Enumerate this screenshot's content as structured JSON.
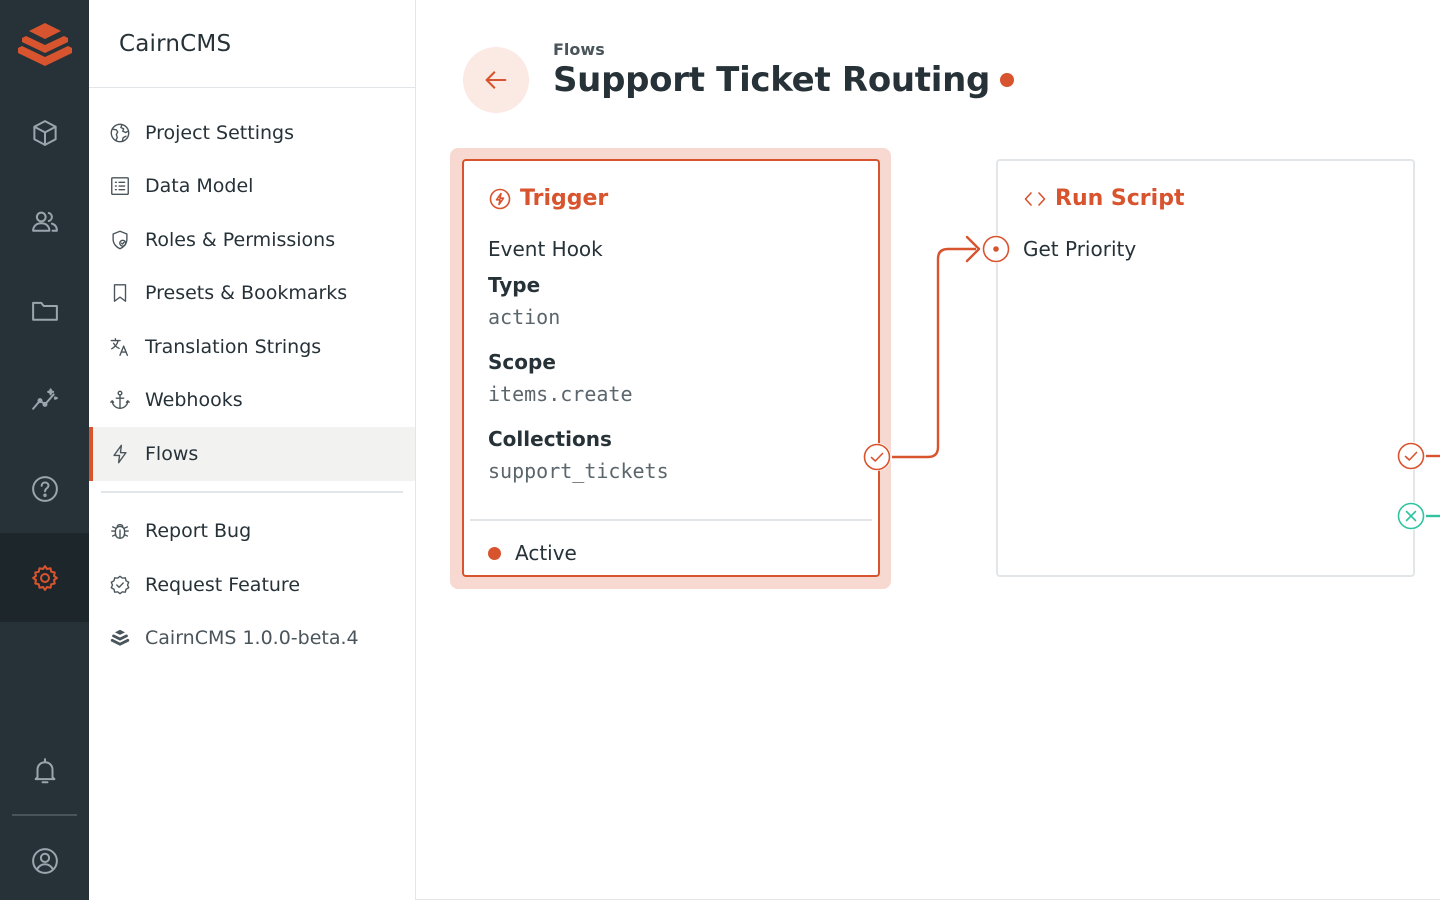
{
  "app": {
    "name": "CairnCMS",
    "accent_color": "#d8542f",
    "rail_color": "#263238",
    "success_color": "#2ec4a0"
  },
  "rail": {
    "logo_icon": "cairn-stack-icon",
    "items": [
      {
        "icon": "box-icon",
        "name": "content"
      },
      {
        "icon": "users-icon",
        "name": "user-directory"
      },
      {
        "icon": "folder-icon",
        "name": "file-library"
      },
      {
        "icon": "insights-icon",
        "name": "insights"
      },
      {
        "icon": "help-icon",
        "name": "documentation"
      },
      {
        "icon": "gear-icon",
        "name": "settings",
        "active": true
      }
    ],
    "bottom": [
      {
        "icon": "bell-icon",
        "name": "notifications"
      },
      {
        "icon": "account-icon",
        "name": "user-profile"
      }
    ]
  },
  "sidebar": {
    "title": "CairnCMS",
    "items": [
      {
        "label": "Project Settings",
        "icon": "globe-icon"
      },
      {
        "label": "Data Model",
        "icon": "list-alt-icon"
      },
      {
        "label": "Roles & Permissions",
        "icon": "shield-icon"
      },
      {
        "label": "Presets & Bookmarks",
        "icon": "bookmark-icon"
      },
      {
        "label": "Translation Strings",
        "icon": "translate-icon"
      },
      {
        "label": "Webhooks",
        "icon": "anchor-icon"
      },
      {
        "label": "Flows",
        "icon": "bolt-icon",
        "active": true
      }
    ],
    "secondary": [
      {
        "label": "Report Bug",
        "icon": "bug-icon"
      },
      {
        "label": "Request Feature",
        "icon": "verified-icon"
      },
      {
        "label": "CairnCMS 1.0.0-beta.4",
        "icon": "cairn-stack-icon"
      }
    ]
  },
  "header": {
    "breadcrumb": "Flows",
    "title": "Support Ticket Routing",
    "back_icon": "arrow-left-icon"
  },
  "trigger": {
    "heading": "Trigger",
    "icon": "bolt-circle-icon",
    "name": "Event Hook",
    "fields": [
      {
        "label": "Type",
        "value": "action"
      },
      {
        "label": "Scope",
        "value": "items.create"
      },
      {
        "label": "Collections",
        "value": "support_tickets"
      }
    ],
    "status": "Active"
  },
  "operation": {
    "heading": "Run Script",
    "icon": "code-icon",
    "name": "Get Priority"
  }
}
